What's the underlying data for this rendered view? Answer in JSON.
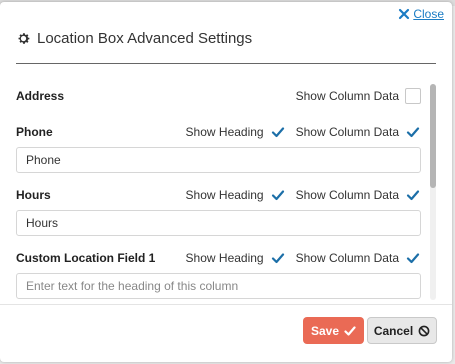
{
  "close_label": "Close",
  "title": "Location Box Advanced Settings",
  "fields": [
    {
      "name": "Address",
      "show_heading": null,
      "show_column_data": false,
      "input_value": null,
      "input_placeholder": null
    },
    {
      "name": "Phone",
      "show_heading": true,
      "show_column_data": true,
      "input_value": "Phone",
      "input_placeholder": ""
    },
    {
      "name": "Hours",
      "show_heading": true,
      "show_column_data": true,
      "input_value": "Hours",
      "input_placeholder": ""
    },
    {
      "name": "Custom Location Field 1",
      "show_heading": true,
      "show_column_data": true,
      "input_value": "",
      "input_placeholder": "Enter text for the heading of this column"
    }
  ],
  "labels": {
    "show_heading": "Show Heading",
    "show_column_data": "Show Column Data"
  },
  "buttons": {
    "save": "Save",
    "cancel": "Cancel"
  },
  "colors": {
    "accent": "#1b7cc4",
    "save_bg": "#ea6a55",
    "check": "#1c6fa8"
  }
}
